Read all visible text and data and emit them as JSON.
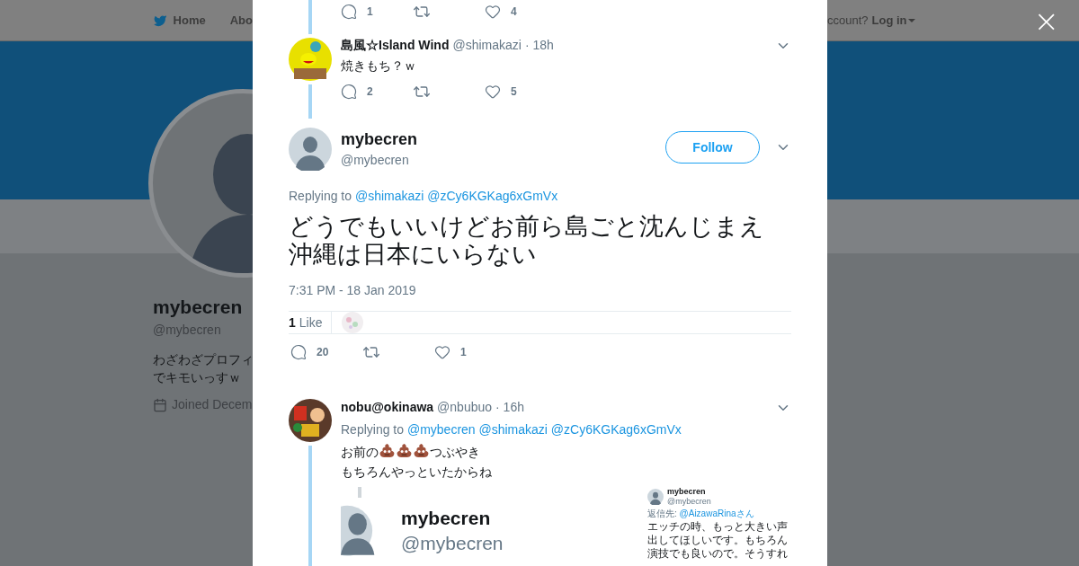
{
  "background_page": {
    "nav": {
      "home": "Home",
      "about": "Abo",
      "account_prompt": "ccount?",
      "login": "Log in"
    },
    "profile": {
      "name": "mybecren",
      "handle": "@mybecren",
      "bio_lines": [
        "わざわざプロフィ",
        "でキモいっすｗ"
      ],
      "joined": "Joined Decem"
    }
  },
  "modal": {
    "previous_tweet": {
      "reply_count": "1",
      "like_count": "4"
    },
    "parent_tweet": {
      "name": "島風☆Island Wind",
      "handle": "@shimakazi",
      "time": "· 18h",
      "text": "焼きもち？ｗ",
      "reply_count": "2",
      "like_count": "5"
    },
    "main_tweet": {
      "name": "mybecren",
      "handle": "@mybecren",
      "follow": "Follow",
      "replying_label": "Replying to",
      "mentions": [
        "@shimakazi",
        "@zCy6KGKag6xGmVx"
      ],
      "text_lines": [
        "どうでもいいけどお前ら島ごと沈んじまえ",
        "沖縄は日本にいらない"
      ],
      "timestamp": "7:31 PM - 18 Jan 2019",
      "likes_count": "1",
      "likes_label": "Like",
      "reply_count": "20",
      "like_count": "1"
    },
    "replies": [
      {
        "name": "nobu@okinawa",
        "handle": "@nbubuo",
        "time": "· 16h",
        "replying_label": "Replying to",
        "mentions": [
          "@mybecren",
          "@shimakazi",
          "@zCy6KGKag6xGmVx"
        ],
        "lines": [
          [
            {
              "kind": "text",
              "text": "お前の"
            },
            {
              "kind": "emoji"
            },
            {
              "kind": "emoji"
            },
            {
              "kind": "emoji"
            },
            {
              "kind": "text",
              "text": "つぶやき"
            }
          ],
          [
            {
              "kind": "text",
              "text": "もちろんやっといたからね"
            }
          ]
        ],
        "attachment": {
          "large": {
            "name": "mybecren",
            "handle": "@mybecren"
          },
          "small": {
            "name": "mybecren",
            "handle": "@mybecren",
            "reply_prefix": "返信先:",
            "reply_mention": "@AizawaRinaさん",
            "text": "エッチの時、もっと大きい声出してほしいです。もちろん演技でも良いので。そうすれ"
          }
        }
      }
    ]
  },
  "close": "×"
}
